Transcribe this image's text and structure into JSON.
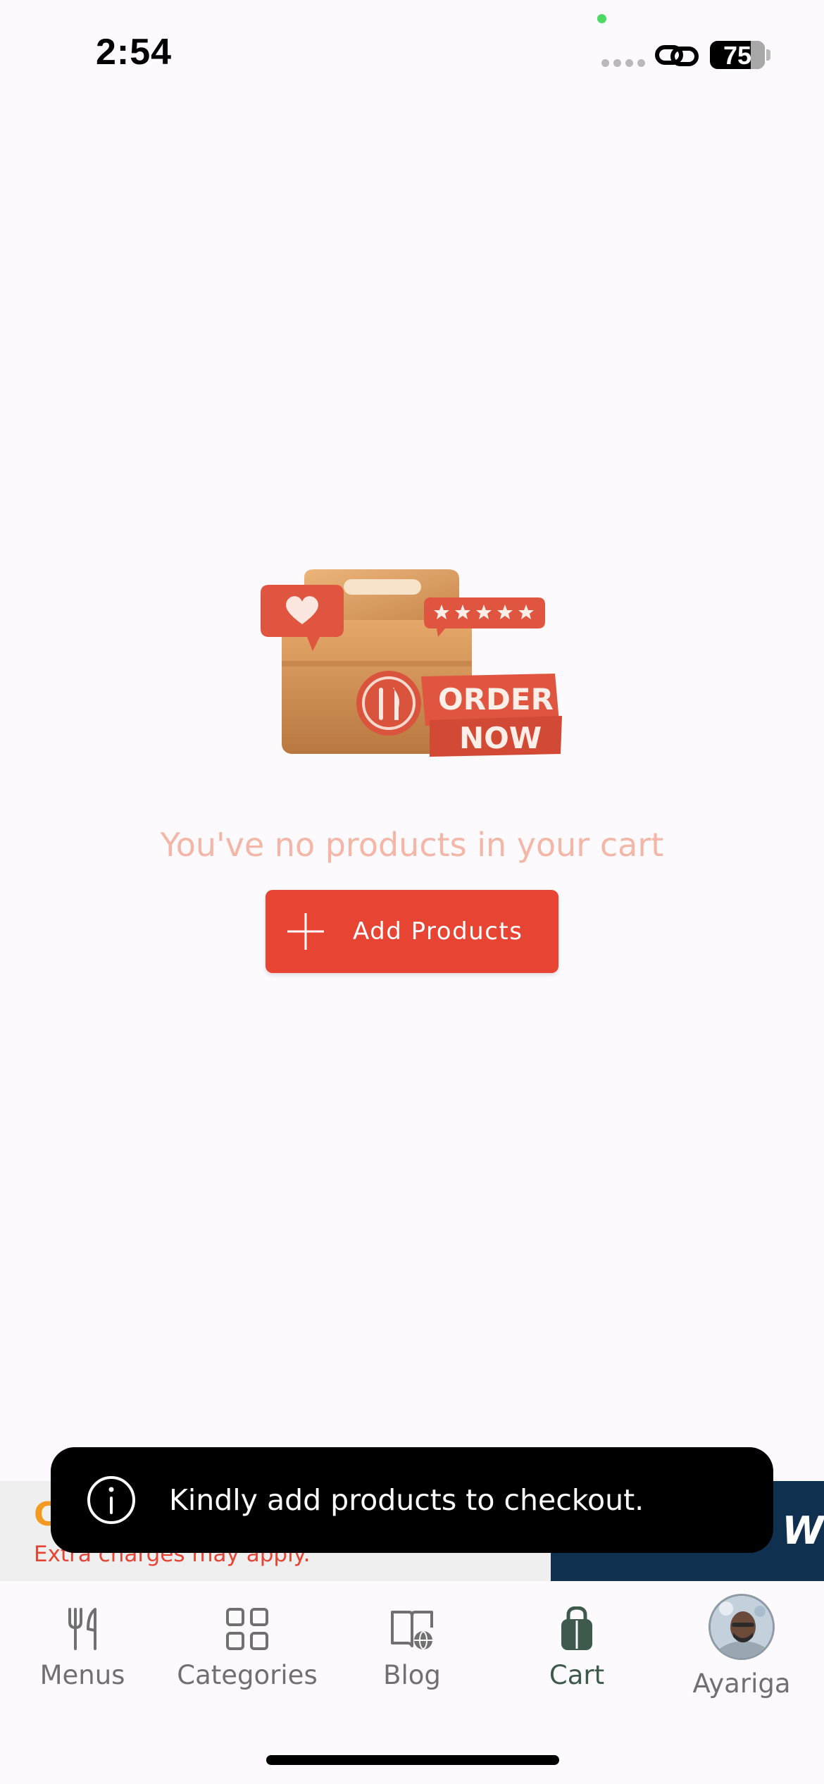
{
  "status_bar": {
    "time": "2:54",
    "battery": "75"
  },
  "illustration": {
    "badge_line1": "ORDER",
    "badge_line2": "NOW"
  },
  "empty_state": {
    "message": "You've no products in your cart",
    "button_label": "Add Products"
  },
  "promo": {
    "headline": "C",
    "subtext": "Extra charges may apply.",
    "cta": "W"
  },
  "toast": {
    "message": "Kindly add products to checkout."
  },
  "bottom_nav": {
    "items": [
      {
        "label": "Menus",
        "icon": "fork-knife-icon"
      },
      {
        "label": "Categories",
        "icon": "grid-icon"
      },
      {
        "label": "Blog",
        "icon": "book-globe-icon"
      },
      {
        "label": "Cart",
        "icon": "shopping-bag-icon",
        "active": true
      },
      {
        "label": "Ayariga",
        "icon": "avatar"
      }
    ]
  },
  "colors": {
    "accent": "#e84434",
    "promo_orange": "#f39a21",
    "navy": "#10304f",
    "active_nav": "#3d5a4d",
    "inactive_nav": "#707070",
    "background": "#fcfafc"
  }
}
